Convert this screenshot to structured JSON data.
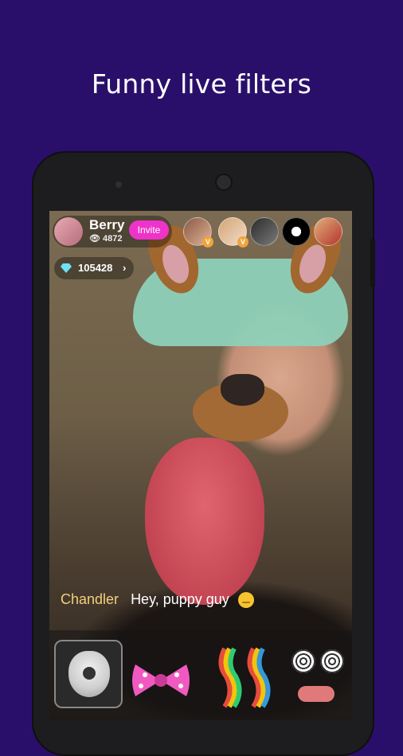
{
  "headline": "Funny live filters",
  "stream": {
    "host_name": "Berry",
    "viewer_count": "4872",
    "invite_label": "Invite",
    "coin_balance": "105428"
  },
  "chat": {
    "user": "Chandler",
    "message": "Hey, puppy guy"
  },
  "viewers": [
    {
      "badge": "V"
    },
    {
      "badge": "V"
    },
    {
      "badge": ""
    },
    {
      "badge": ""
    },
    {
      "badge": ""
    }
  ],
  "filters": [
    {
      "name": "white-dog-filter",
      "selected": true
    },
    {
      "name": "pink-bow-filter",
      "selected": false
    },
    {
      "name": "rainbow-filter",
      "selected": false
    },
    {
      "name": "dizzy-eyes-filter",
      "selected": false
    }
  ],
  "colors": {
    "background": "#2a0f6a",
    "invite_button": "#ee33c9",
    "chat_username": "#f1d07a"
  }
}
